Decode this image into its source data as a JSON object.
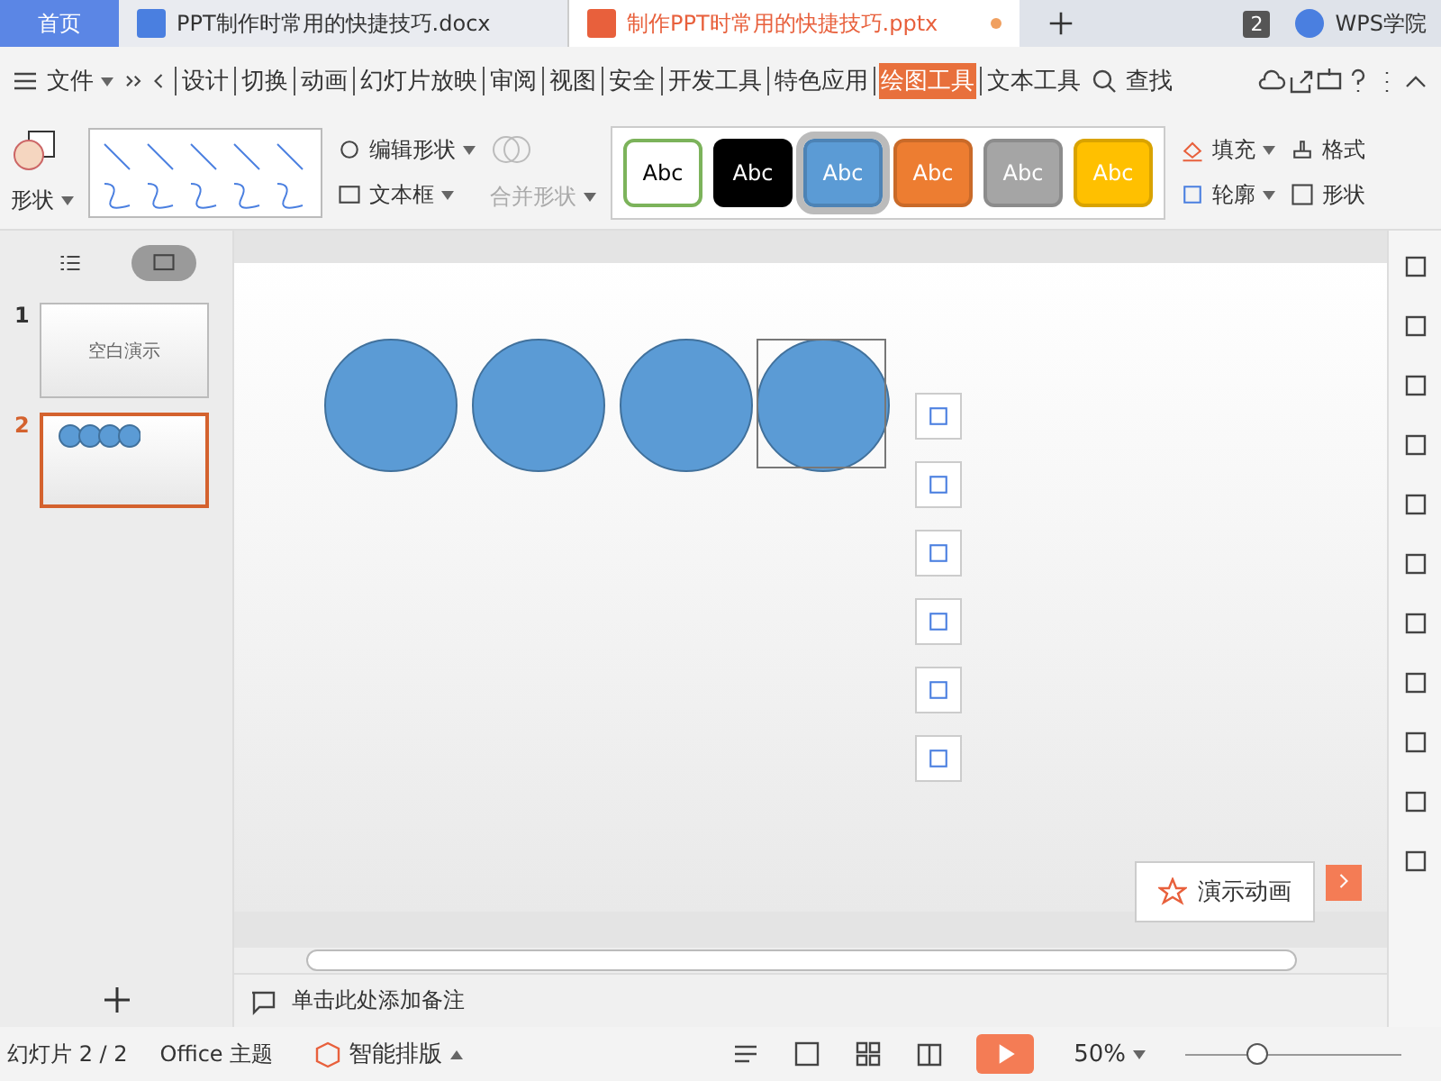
{
  "doc_tabs": [
    {
      "label": "首页",
      "kind": "home",
      "selected": false
    },
    {
      "label": "PPT制作时常用的快捷技巧.docx",
      "kind": "docx",
      "selected": false
    },
    {
      "label": "制作PPT时常用的快捷技巧.pptx",
      "kind": "pptx",
      "selected": true
    }
  ],
  "window_count": "2",
  "academy": "WPS学院",
  "file_menu": "文件",
  "menu_items": [
    {
      "label": "设计",
      "selected": false
    },
    {
      "label": "切换",
      "selected": false
    },
    {
      "label": "动画",
      "selected": false
    },
    {
      "label": "幻灯片放映",
      "selected": false
    },
    {
      "label": "审阅",
      "selected": false
    },
    {
      "label": "视图",
      "selected": false
    },
    {
      "label": "安全",
      "selected": false
    },
    {
      "label": "开发工具",
      "selected": false
    },
    {
      "label": "特色应用",
      "selected": false
    },
    {
      "label": "绘图工具",
      "selected": true
    },
    {
      "label": "文本工具",
      "selected": false
    }
  ],
  "search": "查找",
  "ribbon": {
    "shape": "形状",
    "edit_shape": "编辑形状",
    "text_box": "文本框",
    "merge_shapes": "合并形状",
    "fill": "填充",
    "outline": "轮廓",
    "format": "格式",
    "shape_effect": "形状"
  },
  "styles": [
    {
      "label": "Abc",
      "color": "#ffffff",
      "selected": false
    },
    {
      "label": "Abc",
      "color": "#000000",
      "selected": false
    },
    {
      "label": "Abc",
      "color": "#5b9bd5",
      "selected": true
    },
    {
      "label": "Abc",
      "color": "#ed7d31",
      "selected": false
    },
    {
      "label": "Abc",
      "color": "#a5a5a5",
      "selected": false
    },
    {
      "label": "Abc",
      "color": "#ffc000",
      "selected": false
    }
  ],
  "slides": [
    {
      "number": "1",
      "title": "空白演示",
      "selected": false
    },
    {
      "number": "2",
      "selected": true
    }
  ],
  "panel_views": [
    {
      "kind": "outline",
      "selected": false
    },
    {
      "kind": "slides",
      "selected": true
    }
  ],
  "zoom_slider": {
    "level": 0.33
  },
  "animate_button": "演示动画",
  "notes_placeholder": "单击此处添加备注",
  "status_bar": {
    "slide": "幻灯片 2 / 2",
    "theme": "Office 主题",
    "smart_layout": "智能排版",
    "zoom": "50%"
  }
}
